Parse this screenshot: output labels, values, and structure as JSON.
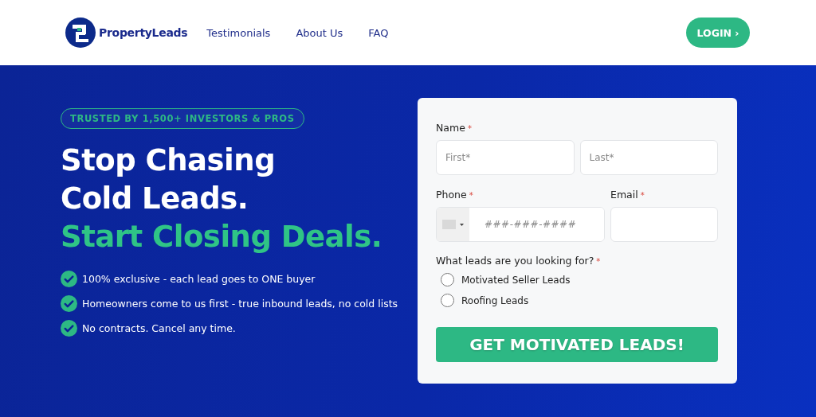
{
  "header": {
    "brand": "PropertyLeads",
    "nav": [
      {
        "label": "Testimonials"
      },
      {
        "label": "About Us"
      },
      {
        "label": "FAQ"
      }
    ],
    "login": "LOGIN ›"
  },
  "hero": {
    "badge": "TRUSTED BY 1,500+ INVESTORS & PROS",
    "headline": [
      "Stop Chasing",
      "Cold Leads."
    ],
    "headline_accent": "Start Closing Deals.",
    "benefits": [
      "100% exclusive - each lead goes to ONE buyer",
      "Homeowners come to us first - true inbound leads, no cold lists",
      "No contracts. Cancel any time."
    ]
  },
  "form": {
    "name": {
      "label": "Name",
      "mark": "*",
      "first_placeholder": "First*",
      "last_placeholder": "Last*"
    },
    "phone": {
      "label": "Phone",
      "mark": "*",
      "placeholder": "###-###-####"
    },
    "email": {
      "label": "Email",
      "mark": "*"
    },
    "leads": {
      "question": "What leads are you looking for?",
      "mark": "*",
      "options": [
        {
          "label": "Motivated Seller Leads",
          "selected": false
        },
        {
          "label": "Roofing Leads",
          "selected": false
        }
      ]
    },
    "submit": "GET MOTIVATED LEADS!"
  }
}
